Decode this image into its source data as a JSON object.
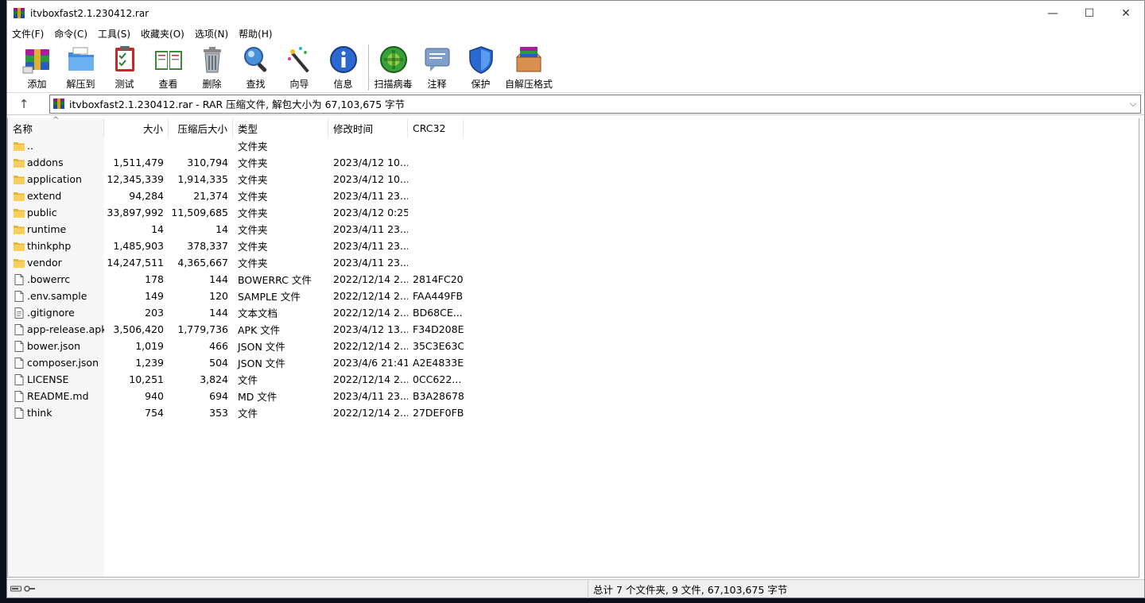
{
  "window": {
    "title": "itvboxfast2.1.230412.rar",
    "controls": {
      "minimize": "—",
      "maximize": "☐",
      "close": "✕"
    }
  },
  "menu": [
    "文件(F)",
    "命令(C)",
    "工具(S)",
    "收藏夹(O)",
    "选项(N)",
    "帮助(H)"
  ],
  "toolbar": [
    {
      "label": "添加",
      "icon": "add-archive-icon"
    },
    {
      "label": "解压到",
      "icon": "extract-to-icon"
    },
    {
      "label": "测试",
      "icon": "test-icon"
    },
    {
      "label": "查看",
      "icon": "view-icon"
    },
    {
      "label": "删除",
      "icon": "delete-icon"
    },
    {
      "label": "查找",
      "icon": "find-icon"
    },
    {
      "label": "向导",
      "icon": "wizard-icon"
    },
    {
      "label": "信息",
      "icon": "info-icon"
    },
    {
      "label": "扫描病毒",
      "icon": "virus-scan-icon"
    },
    {
      "label": "注释",
      "icon": "comment-icon"
    },
    {
      "label": "保护",
      "icon": "protect-icon"
    },
    {
      "label": "自解压格式",
      "icon": "sfx-icon"
    }
  ],
  "address": {
    "up": "↑",
    "text": "itvboxfast2.1.230412.rar - RAR 压缩文件, 解包大小为 67,103,675 字节",
    "dropdown": "⌵"
  },
  "columns": {
    "name": "名称",
    "size": "大小",
    "packed": "压缩后大小",
    "type": "类型",
    "modified": "修改时间",
    "crc": "CRC32",
    "sort_indicator": "^"
  },
  "files": [
    {
      "name": "..",
      "size": "",
      "packed": "",
      "type": "文件夹",
      "modified": "",
      "crc": "",
      "kind": "folder"
    },
    {
      "name": "addons",
      "size": "1,511,479",
      "packed": "310,794",
      "type": "文件夹",
      "modified": "2023/4/12 10...",
      "crc": "",
      "kind": "folder"
    },
    {
      "name": "application",
      "size": "12,345,339",
      "packed": "1,914,335",
      "type": "文件夹",
      "modified": "2023/4/12 10...",
      "crc": "",
      "kind": "folder"
    },
    {
      "name": "extend",
      "size": "94,284",
      "packed": "21,374",
      "type": "文件夹",
      "modified": "2023/4/11 23...",
      "crc": "",
      "kind": "folder"
    },
    {
      "name": "public",
      "size": "33,897,992",
      "packed": "11,509,685",
      "type": "文件夹",
      "modified": "2023/4/12 0:25",
      "crc": "",
      "kind": "folder"
    },
    {
      "name": "runtime",
      "size": "14",
      "packed": "14",
      "type": "文件夹",
      "modified": "2023/4/11 23...",
      "crc": "",
      "kind": "folder"
    },
    {
      "name": "thinkphp",
      "size": "1,485,903",
      "packed": "378,337",
      "type": "文件夹",
      "modified": "2023/4/11 23...",
      "crc": "",
      "kind": "folder"
    },
    {
      "name": "vendor",
      "size": "14,247,511",
      "packed": "4,365,667",
      "type": "文件夹",
      "modified": "2023/4/11 23...",
      "crc": "",
      "kind": "folder"
    },
    {
      "name": ".bowerrc",
      "size": "178",
      "packed": "144",
      "type": "BOWERRC 文件",
      "modified": "2022/12/14 2...",
      "crc": "2814FC20",
      "kind": "file"
    },
    {
      "name": ".env.sample",
      "size": "149",
      "packed": "120",
      "type": "SAMPLE 文件",
      "modified": "2022/12/14 2...",
      "crc": "FAA449FB",
      "kind": "file"
    },
    {
      "name": ".gitignore",
      "size": "203",
      "packed": "144",
      "type": "文本文档",
      "modified": "2022/12/14 2...",
      "crc": "BD68CE...",
      "kind": "text"
    },
    {
      "name": "app-release.apk",
      "size": "3,506,420",
      "packed": "1,779,736",
      "type": "APK 文件",
      "modified": "2023/4/12 13...",
      "crc": "F34D208E",
      "kind": "file"
    },
    {
      "name": "bower.json",
      "size": "1,019",
      "packed": "466",
      "type": "JSON 文件",
      "modified": "2022/12/14 2...",
      "crc": "35C3E63C",
      "kind": "file"
    },
    {
      "name": "composer.json",
      "size": "1,239",
      "packed": "504",
      "type": "JSON 文件",
      "modified": "2023/4/6 21:41",
      "crc": "A2E4833E",
      "kind": "file"
    },
    {
      "name": "LICENSE",
      "size": "10,251",
      "packed": "3,824",
      "type": "文件",
      "modified": "2022/12/14 2...",
      "crc": "0CC622...",
      "kind": "file"
    },
    {
      "name": "README.md",
      "size": "940",
      "packed": "694",
      "type": "MD 文件",
      "modified": "2023/4/11 23...",
      "crc": "B3A28678",
      "kind": "file"
    },
    {
      "name": "think",
      "size": "754",
      "packed": "353",
      "type": "文件",
      "modified": "2022/12/14 2...",
      "crc": "27DEF0FB",
      "kind": "file"
    }
  ],
  "status": {
    "summary": "总计 7 个文件夹, 9 文件, 67,103,675 字节"
  }
}
